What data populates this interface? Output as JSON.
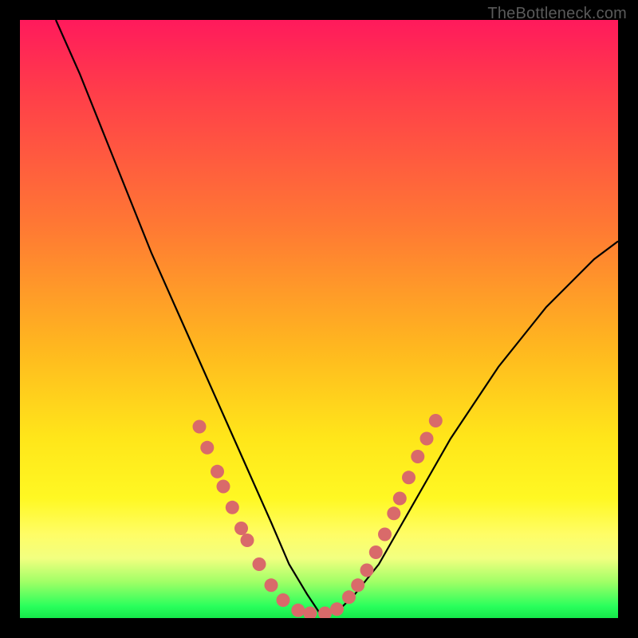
{
  "watermark": "TheBottleneck.com",
  "chart_data": {
    "type": "line",
    "title": "",
    "xlabel": "",
    "ylabel": "",
    "xlim": [
      0,
      100
    ],
    "ylim": [
      0,
      100
    ],
    "series": [
      {
        "name": "bottleneck-curve",
        "x": [
          6,
          10,
          14,
          18,
          22,
          26,
          30,
          34,
          38,
          42,
          45,
          48,
          50,
          53,
          56,
          60,
          64,
          68,
          72,
          76,
          80,
          84,
          88,
          92,
          96,
          100
        ],
        "values": [
          100,
          91,
          81,
          71,
          61,
          52,
          43,
          34,
          25,
          16,
          9,
          4,
          1,
          1,
          4,
          9,
          16,
          23,
          30,
          36,
          42,
          47,
          52,
          56,
          60,
          63
        ]
      }
    ],
    "markers": [
      {
        "x": 30.0,
        "y": 32.0
      },
      {
        "x": 31.3,
        "y": 28.5
      },
      {
        "x": 33.0,
        "y": 24.5
      },
      {
        "x": 34.0,
        "y": 22.0
      },
      {
        "x": 35.5,
        "y": 18.5
      },
      {
        "x": 37.0,
        "y": 15.0
      },
      {
        "x": 38.0,
        "y": 13.0
      },
      {
        "x": 40.0,
        "y": 9.0
      },
      {
        "x": 42.0,
        "y": 5.5
      },
      {
        "x": 44.0,
        "y": 3.0
      },
      {
        "x": 46.5,
        "y": 1.3
      },
      {
        "x": 48.5,
        "y": 0.8
      },
      {
        "x": 51.0,
        "y": 0.8
      },
      {
        "x": 53.0,
        "y": 1.5
      },
      {
        "x": 55.0,
        "y": 3.5
      },
      {
        "x": 56.5,
        "y": 5.5
      },
      {
        "x": 58.0,
        "y": 8.0
      },
      {
        "x": 59.5,
        "y": 11.0
      },
      {
        "x": 61.0,
        "y": 14.0
      },
      {
        "x": 62.5,
        "y": 17.5
      },
      {
        "x": 63.5,
        "y": 20.0
      },
      {
        "x": 65.0,
        "y": 23.5
      },
      {
        "x": 66.5,
        "y": 27.0
      },
      {
        "x": 68.0,
        "y": 30.0
      },
      {
        "x": 69.5,
        "y": 33.0
      }
    ],
    "marker_color": "#d96a6a",
    "curve_color": "#000000"
  }
}
